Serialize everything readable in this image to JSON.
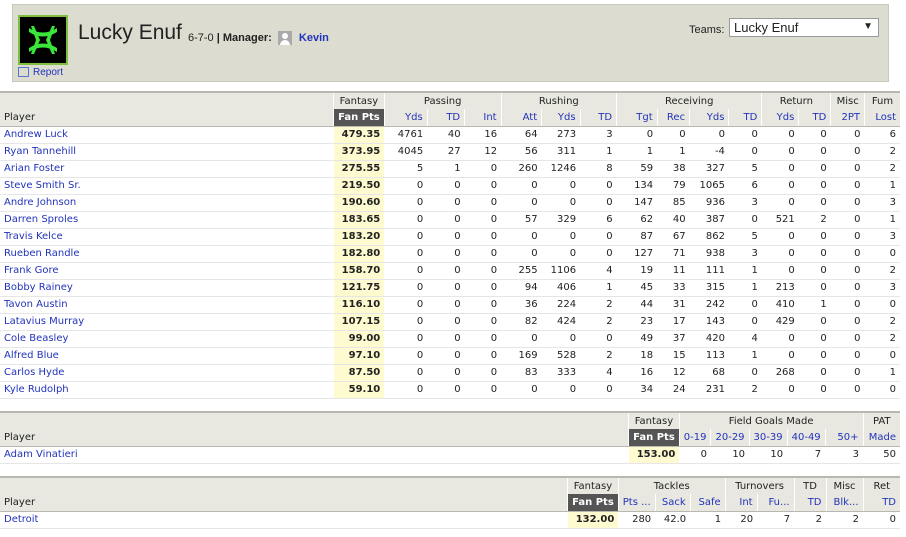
{
  "header": {
    "team_name": "Lucky Enuf",
    "record": "6-7-0",
    "manager_label": "| Manager:",
    "manager_name": "Kevin",
    "report_label": "Report",
    "teams_label": "Teams:",
    "teams_selected": "Lucky Enuf",
    "logo_icon": "under-armour-logo",
    "accent_color": "#2233bb"
  },
  "offense": {
    "groups": [
      "Fantasy",
      "Passing",
      "Rushing",
      "Receiving",
      "Return",
      "Misc",
      "Fum"
    ],
    "columns": [
      "Player",
      "Fan Pts",
      "Yds",
      "TD",
      "Int",
      "Att",
      "Yds",
      "TD",
      "Tgt",
      "Rec",
      "Yds",
      "TD",
      "Yds",
      "TD",
      "2PT",
      "Lost"
    ],
    "rows": [
      [
        "Andrew Luck",
        "479.35",
        "4761",
        "40",
        "16",
        "64",
        "273",
        "3",
        "0",
        "0",
        "0",
        "0",
        "0",
        "0",
        "0",
        "6"
      ],
      [
        "Ryan Tannehill",
        "373.95",
        "4045",
        "27",
        "12",
        "56",
        "311",
        "1",
        "1",
        "1",
        "-4",
        "0",
        "0",
        "0",
        "0",
        "2"
      ],
      [
        "Arian Foster",
        "275.55",
        "5",
        "1",
        "0",
        "260",
        "1246",
        "8",
        "59",
        "38",
        "327",
        "5",
        "0",
        "0",
        "0",
        "2"
      ],
      [
        "Steve Smith Sr.",
        "219.50",
        "0",
        "0",
        "0",
        "0",
        "0",
        "0",
        "134",
        "79",
        "1065",
        "6",
        "0",
        "0",
        "0",
        "1"
      ],
      [
        "Andre Johnson",
        "190.60",
        "0",
        "0",
        "0",
        "0",
        "0",
        "0",
        "147",
        "85",
        "936",
        "3",
        "0",
        "0",
        "0",
        "3"
      ],
      [
        "Darren Sproles",
        "183.65",
        "0",
        "0",
        "0",
        "57",
        "329",
        "6",
        "62",
        "40",
        "387",
        "0",
        "521",
        "2",
        "0",
        "1"
      ],
      [
        "Travis Kelce",
        "183.20",
        "0",
        "0",
        "0",
        "0",
        "0",
        "0",
        "87",
        "67",
        "862",
        "5",
        "0",
        "0",
        "0",
        "3"
      ],
      [
        "Rueben Randle",
        "182.80",
        "0",
        "0",
        "0",
        "0",
        "0",
        "0",
        "127",
        "71",
        "938",
        "3",
        "0",
        "0",
        "0",
        "0"
      ],
      [
        "Frank Gore",
        "158.70",
        "0",
        "0",
        "0",
        "255",
        "1106",
        "4",
        "19",
        "11",
        "111",
        "1",
        "0",
        "0",
        "0",
        "2"
      ],
      [
        "Bobby Rainey",
        "121.75",
        "0",
        "0",
        "0",
        "94",
        "406",
        "1",
        "45",
        "33",
        "315",
        "1",
        "213",
        "0",
        "0",
        "3"
      ],
      [
        "Tavon Austin",
        "116.10",
        "0",
        "0",
        "0",
        "36",
        "224",
        "2",
        "44",
        "31",
        "242",
        "0",
        "410",
        "1",
        "0",
        "0"
      ],
      [
        "Latavius Murray",
        "107.15",
        "0",
        "0",
        "0",
        "82",
        "424",
        "2",
        "23",
        "17",
        "143",
        "0",
        "429",
        "0",
        "0",
        "2"
      ],
      [
        "Cole Beasley",
        "99.00",
        "0",
        "0",
        "0",
        "0",
        "0",
        "0",
        "49",
        "37",
        "420",
        "4",
        "0",
        "0",
        "0",
        "2"
      ],
      [
        "Alfred Blue",
        "97.10",
        "0",
        "0",
        "0",
        "169",
        "528",
        "2",
        "18",
        "15",
        "113",
        "1",
        "0",
        "0",
        "0",
        "0"
      ],
      [
        "Carlos Hyde",
        "87.50",
        "0",
        "0",
        "0",
        "83",
        "333",
        "4",
        "16",
        "12",
        "68",
        "0",
        "268",
        "0",
        "0",
        "1"
      ],
      [
        "Kyle Rudolph",
        "59.10",
        "0",
        "0",
        "0",
        "0",
        "0",
        "0",
        "34",
        "24",
        "231",
        "2",
        "0",
        "0",
        "0",
        "0"
      ]
    ]
  },
  "kicker": {
    "groups": [
      "Fantasy",
      "Field Goals Made",
      "PAT"
    ],
    "columns": [
      "Player",
      "Fan Pts",
      "0-19",
      "20-29",
      "30-39",
      "40-49",
      "50+",
      "Made"
    ],
    "rows": [
      [
        "Adam Vinatieri",
        "153.00",
        "0",
        "10",
        "10",
        "7",
        "3",
        "50"
      ]
    ]
  },
  "defense": {
    "groups": [
      "Fantasy",
      "Tackles",
      "Turnovers",
      "TD",
      "Misc",
      "Ret"
    ],
    "columns": [
      "Player",
      "Fan Pts",
      "Pts ...",
      "Sack",
      "Safe",
      "Int",
      "Fu...",
      "TD",
      "Blk...",
      "TD"
    ],
    "rows": [
      [
        "Detroit",
        "132.00",
        "280",
        "42.0",
        "1",
        "20",
        "7",
        "2",
        "2",
        "0"
      ]
    ]
  }
}
